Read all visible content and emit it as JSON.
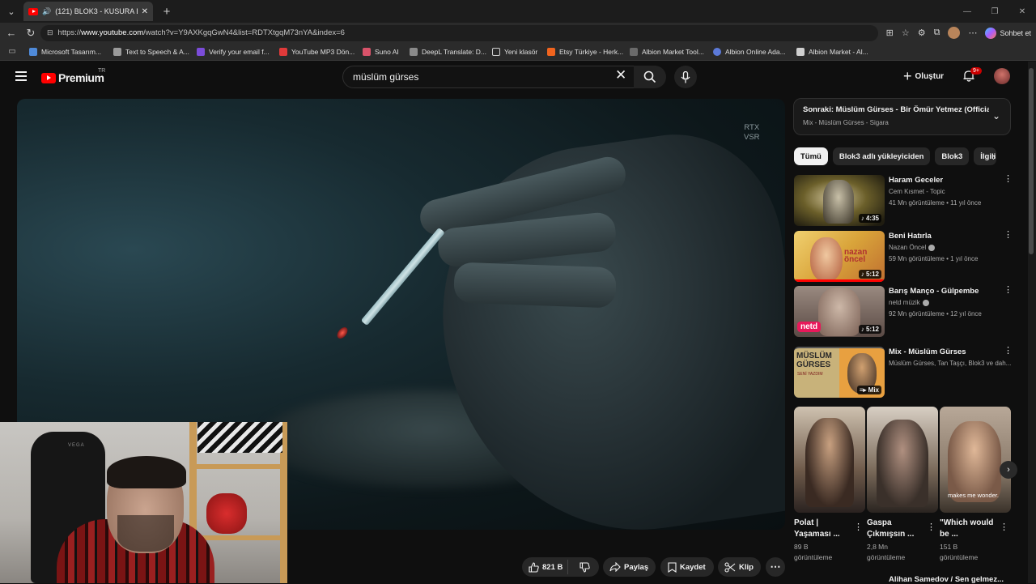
{
  "browser": {
    "tab_title": "(121) BLOK3 - KUSURA BAKMA",
    "url_prefix": "https://",
    "url_host": "www.youtube.com",
    "url_path": "/watch?v=Y9AXKgqGwN4&list=RDTXtgqM73nYA&index=6",
    "copilot_label": "Sohbet et",
    "bookmarks": [
      {
        "label": "Microsoft Tasarım...",
        "color": "#4f8ad9"
      },
      {
        "label": "Text to Speech & A...",
        "color": "#9a9a9a"
      },
      {
        "label": "Verify your email f...",
        "color": "#7b4cd9"
      },
      {
        "label": "YouTube MP3 Dön...",
        "color": "#e03a3a"
      },
      {
        "label": "Suno AI",
        "color": "#d9536a"
      },
      {
        "label": "DeepL Translate: D...",
        "color": "#8a8a8a"
      },
      {
        "label": "Yeni klasör",
        "color": "#9a9a9a"
      },
      {
        "label": "Etsy Türkiye - Herk...",
        "color": "#f1641e"
      },
      {
        "label": "Albion Market Tool...",
        "color": "#6a6a6a"
      },
      {
        "label": "Albion Online Ada...",
        "color": "#5c7ad9"
      },
      {
        "label": "Albion Market - Al...",
        "color": "#cfcfcf"
      }
    ]
  },
  "header": {
    "logo_text": "Premium",
    "logo_region": "TR",
    "search_value": "müslüm gürses",
    "create_label": "Oluştur",
    "notification_count": "9+"
  },
  "player": {
    "overlay_line1": "RTX",
    "overlay_line2": "VSR"
  },
  "actions": {
    "likes": "821 B",
    "share": "Paylaş",
    "save": "Kaydet",
    "clip": "Klip"
  },
  "upnext": {
    "title": "Sonraki: Müslüm Gürses - Bir Ömür Yetmez (Officia...",
    "subtitle": "Mix - Müslüm Gürses - Sigara"
  },
  "chips": [
    "Tümü",
    "Blok3 adlı yükleyiciden",
    "Blok3",
    "İlgili"
  ],
  "videos": [
    {
      "title": "Haram Geceler",
      "channel": "Cem Kısmet - Topic",
      "verified": false,
      "meta": "41 Mn görüntüleme • 11 yıl önce",
      "duration": "4:35",
      "thumb_color": "#6b5f2a"
    },
    {
      "title": "Beni Hatırla",
      "channel": "Nazan Öncel",
      "verified": true,
      "meta": "59 Mn görüntüleme • 1 yıl önce",
      "duration": "5:12",
      "thumb_color": "#d9b34a"
    },
    {
      "title": "Barış Manço - Gülpembe",
      "channel": "netd müzik",
      "verified": true,
      "meta": "92 Mn görüntüleme • 12 yıl önce",
      "duration": "5:12",
      "thumb_color": "#6e5a55"
    },
    {
      "title": "Mix - Müslüm Gürses",
      "channel": "Müslüm Gürses, Tan Taşçı, Blok3 ve dah...",
      "verified": false,
      "meta": "",
      "duration": "Mix",
      "thumb_color": "#2a2a2a"
    }
  ],
  "thumb_texts": {
    "nazan": "nazan öncel",
    "netd": "netd",
    "mix_line1": "MÜSLÜM",
    "mix_line2": "GÜRSES",
    "mix_line3": "SENİ YAZDIM"
  },
  "shorts": [
    {
      "title": "Polat | Yaşaması ...",
      "views": "89 B",
      "views_label": "görüntüleme",
      "thumb_color": "#6e5a4a",
      "caption": ""
    },
    {
      "title": "Gaspa Çıkmışsın ...",
      "views": "2,8 Mn",
      "views_label": "görüntüleme",
      "thumb_color": "#7a6a5a",
      "caption": ""
    },
    {
      "title": "\"Which would be ...",
      "views": "151 B",
      "views_label": "görüntüleme",
      "thumb_color": "#8a7a6a",
      "caption": "makes me wonder."
    }
  ],
  "next_partial_title": "Alihan Samedov / Sen gelmez..."
}
